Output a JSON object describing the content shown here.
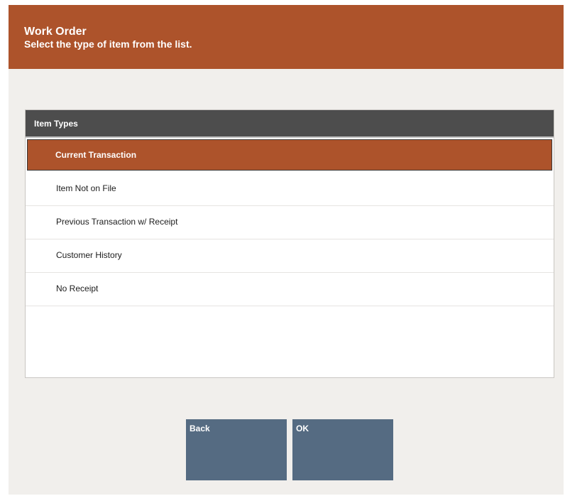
{
  "header": {
    "title": "Work Order",
    "subtitle": "Select the type of item from the list."
  },
  "list": {
    "header_label": "Item Types",
    "items": [
      {
        "label": "Current Transaction",
        "selected": true
      },
      {
        "label": "Item Not on File",
        "selected": false
      },
      {
        "label": "Previous Transaction w/ Receipt",
        "selected": false
      },
      {
        "label": "Customer History",
        "selected": false
      },
      {
        "label": "No Receipt",
        "selected": false
      }
    ]
  },
  "buttons": {
    "back_label": "Back",
    "ok_label": "OK"
  },
  "colors": {
    "header_bg": "#ad532b",
    "selected_row_bg": "#ad532b",
    "list_header_bg": "#4d4d4d",
    "button_bg": "#556b82",
    "page_bg": "#f1efec"
  }
}
